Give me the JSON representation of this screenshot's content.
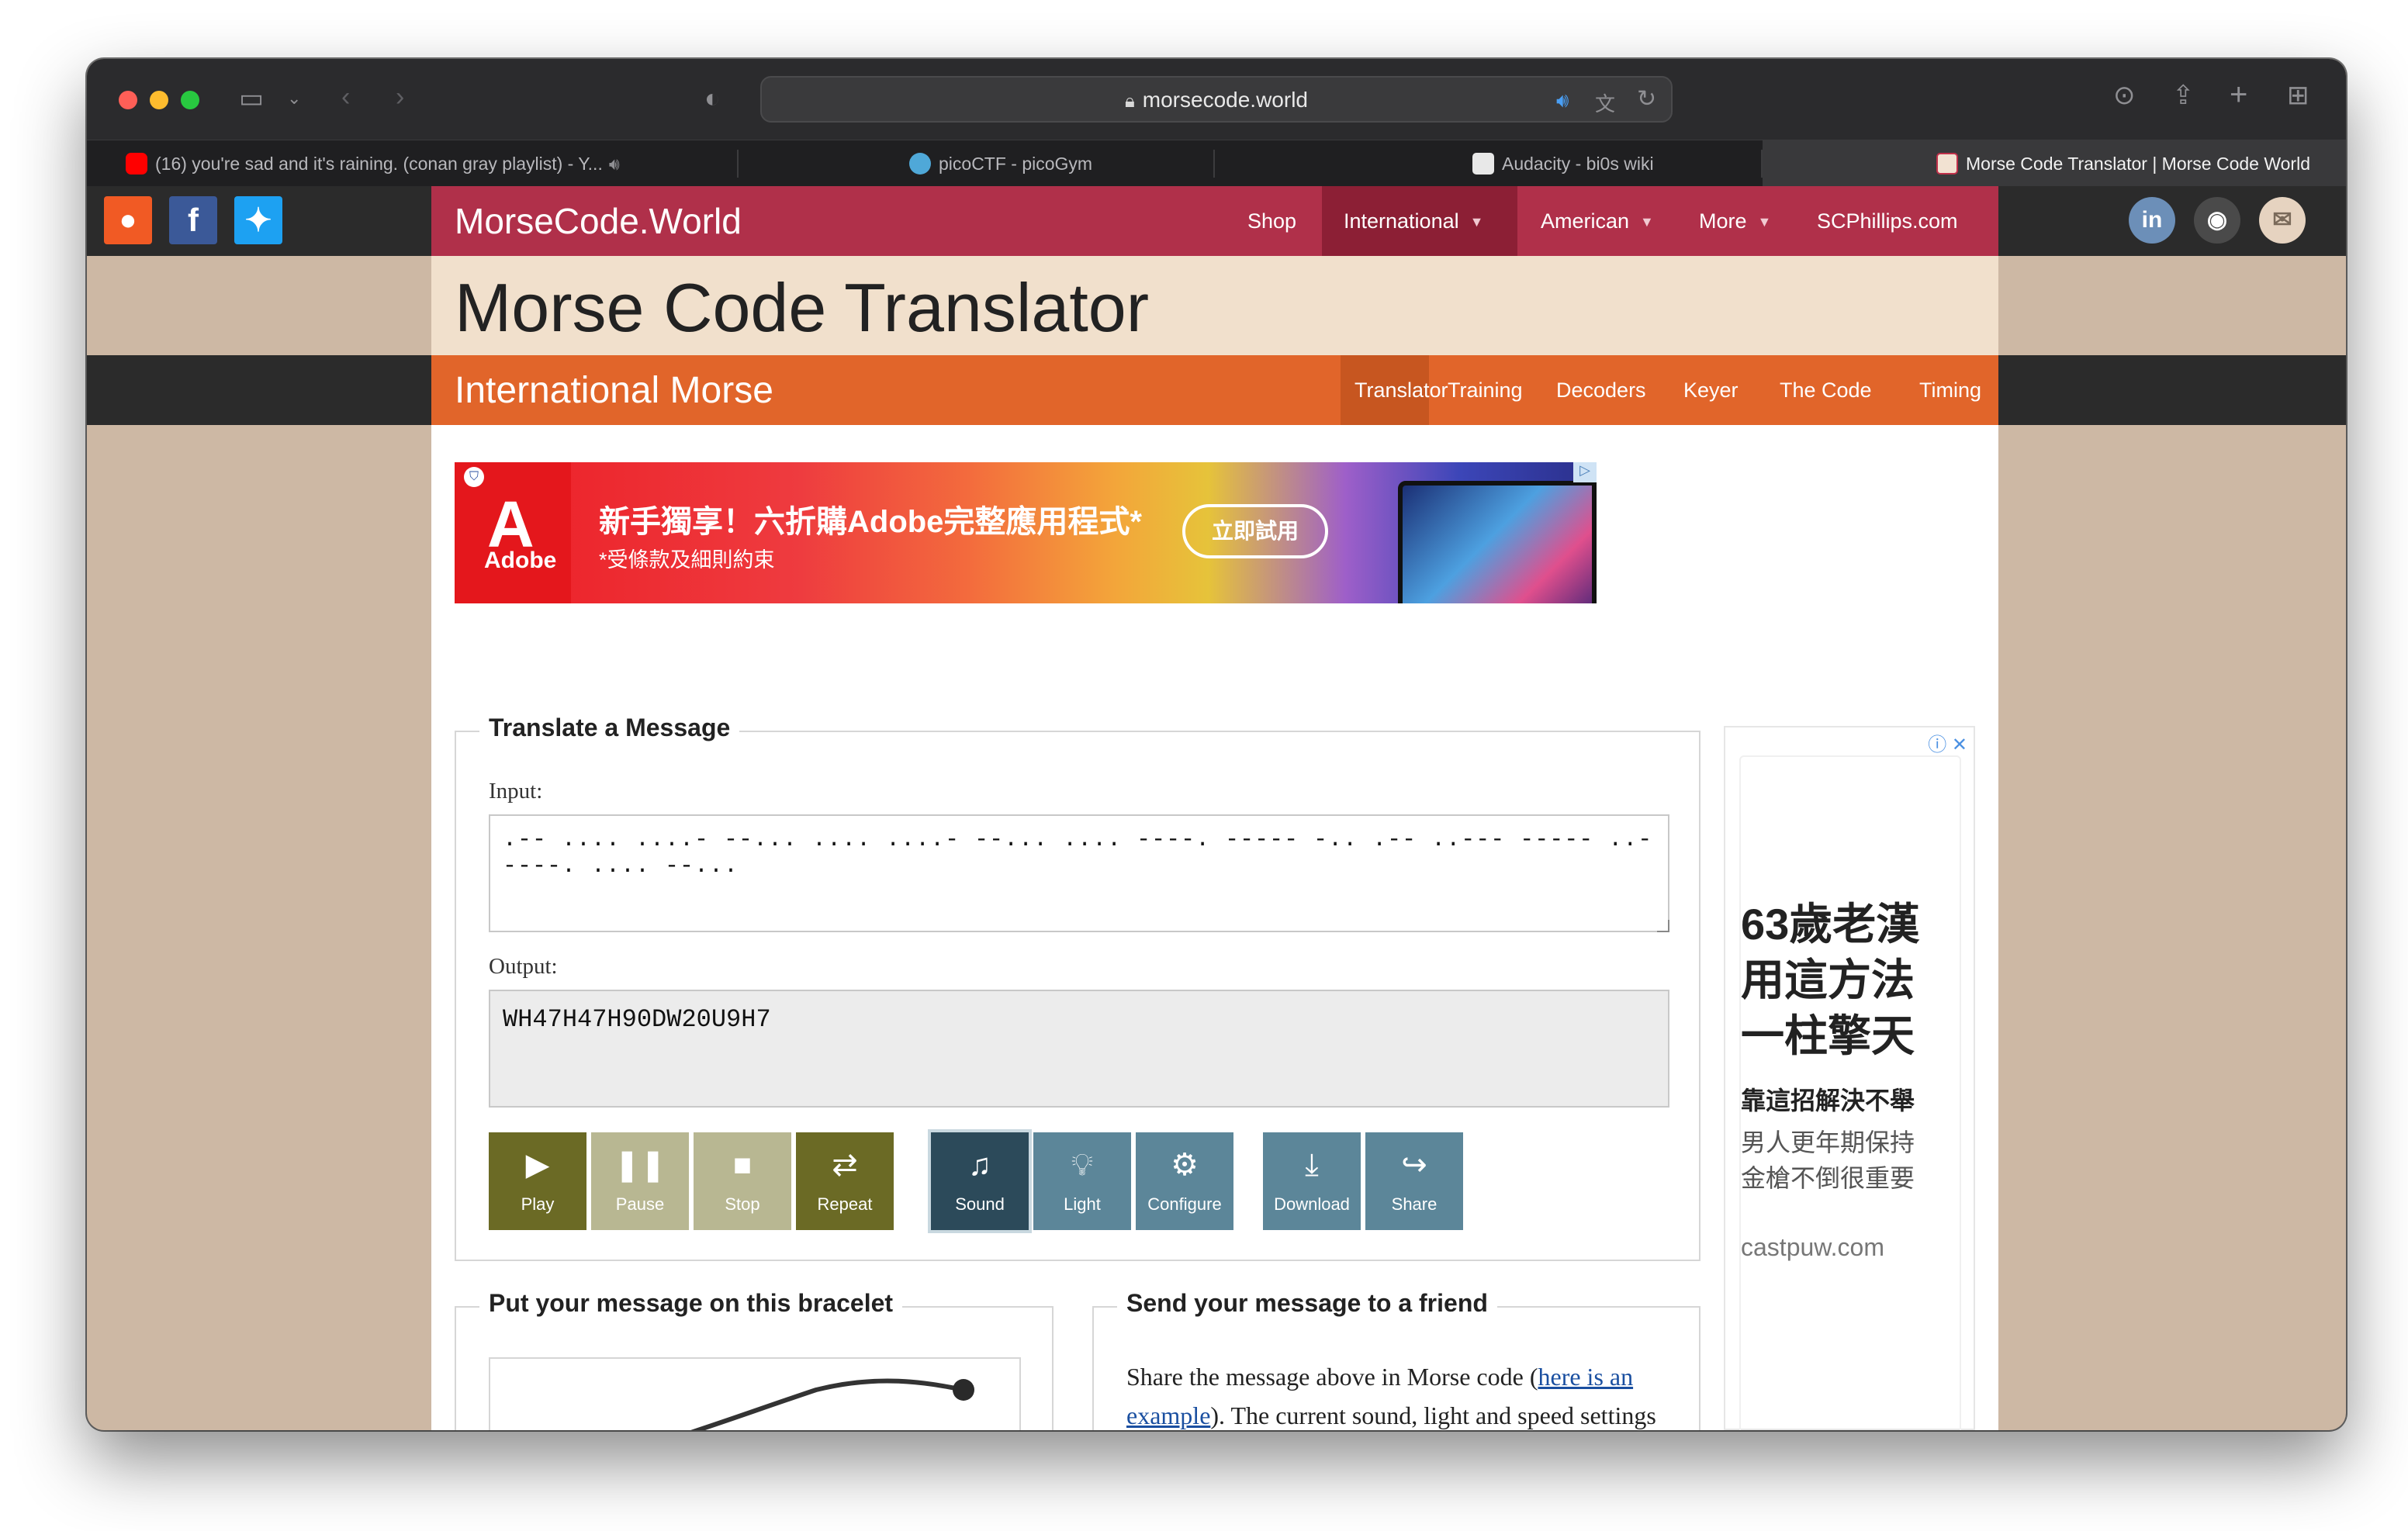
{
  "browser": {
    "url": "morsecode.world",
    "tabs": [
      {
        "title": "(16) you're sad and it's raining. (conan gray playlist) - Y...",
        "favicon": "youtube-icon",
        "audio": true
      },
      {
        "title": "picoCTF - picoGym",
        "favicon": "picoctf-icon"
      },
      {
        "title": "Audacity - bi0s wiki",
        "favicon": "audacity-icon"
      },
      {
        "title": "Morse Code Translator | Morse Code World",
        "favicon": "morse-icon",
        "active": true,
        "audio": true
      }
    ]
  },
  "site": {
    "brand": "MorseCode.World",
    "nav": [
      "Shop",
      "International",
      "American",
      "More",
      "SCPhillips.com"
    ],
    "nav_selected": "International",
    "title": "Morse Code Translator",
    "subtitle": "International Morse",
    "subnav": [
      "Translator",
      "Training",
      "Decoders",
      "Keyer",
      "The Code",
      "Timing"
    ],
    "subnav_selected": "Translator"
  },
  "ad_top": {
    "logo_text": "Adobe",
    "headline": "新手獨享！六折購Adobe完整應用程式*",
    "subline": "*受條款及細則約束",
    "cta": "立即試用"
  },
  "translate": {
    "legend": "Translate a Message",
    "input_label": "Input:",
    "input_value": ".-- .... ....- --... .... ....- --... .... ----. ----- -.. .-- ..--- ----- ..- ----. .... --...",
    "output_label": "Output:",
    "output_value": "WH47H47H90DW20U9H7",
    "controls": [
      {
        "label": "Play",
        "icon": "play-icon"
      },
      {
        "label": "Pause",
        "icon": "pause-icon"
      },
      {
        "label": "Stop",
        "icon": "stop-icon"
      },
      {
        "label": "Repeat",
        "icon": "repeat-icon"
      },
      {
        "label": "Sound",
        "icon": "music-note-icon"
      },
      {
        "label": "Light",
        "icon": "lightbulb-icon"
      },
      {
        "label": "Configure",
        "icon": "gear-icon"
      },
      {
        "label": "Download",
        "icon": "download-icon"
      },
      {
        "label": "Share",
        "icon": "share-icon"
      }
    ]
  },
  "bracelet": {
    "legend": "Put your message on this bracelet"
  },
  "send": {
    "legend": "Send your message to a friend",
    "text_before": "Share the message above in Morse code (",
    "link_text": "here is an example",
    "text_after": "). The current sound, light and speed settings will be used. If they know Morse"
  },
  "side_ad": {
    "headline_lines": [
      "63歲老漢",
      "用這方法",
      "一柱擎天"
    ],
    "subhead": "靠這招解決不舉",
    "body_lines": [
      "男人更年期保持",
      "金槍不倒很重要"
    ],
    "domain": "castpuw.com"
  },
  "colors": {
    "nav_red": "#b0304a",
    "sub_orange": "#e1652a",
    "title_cream": "#f1e0cc",
    "olive": "#6b6a25",
    "teal": "#5c8699"
  }
}
